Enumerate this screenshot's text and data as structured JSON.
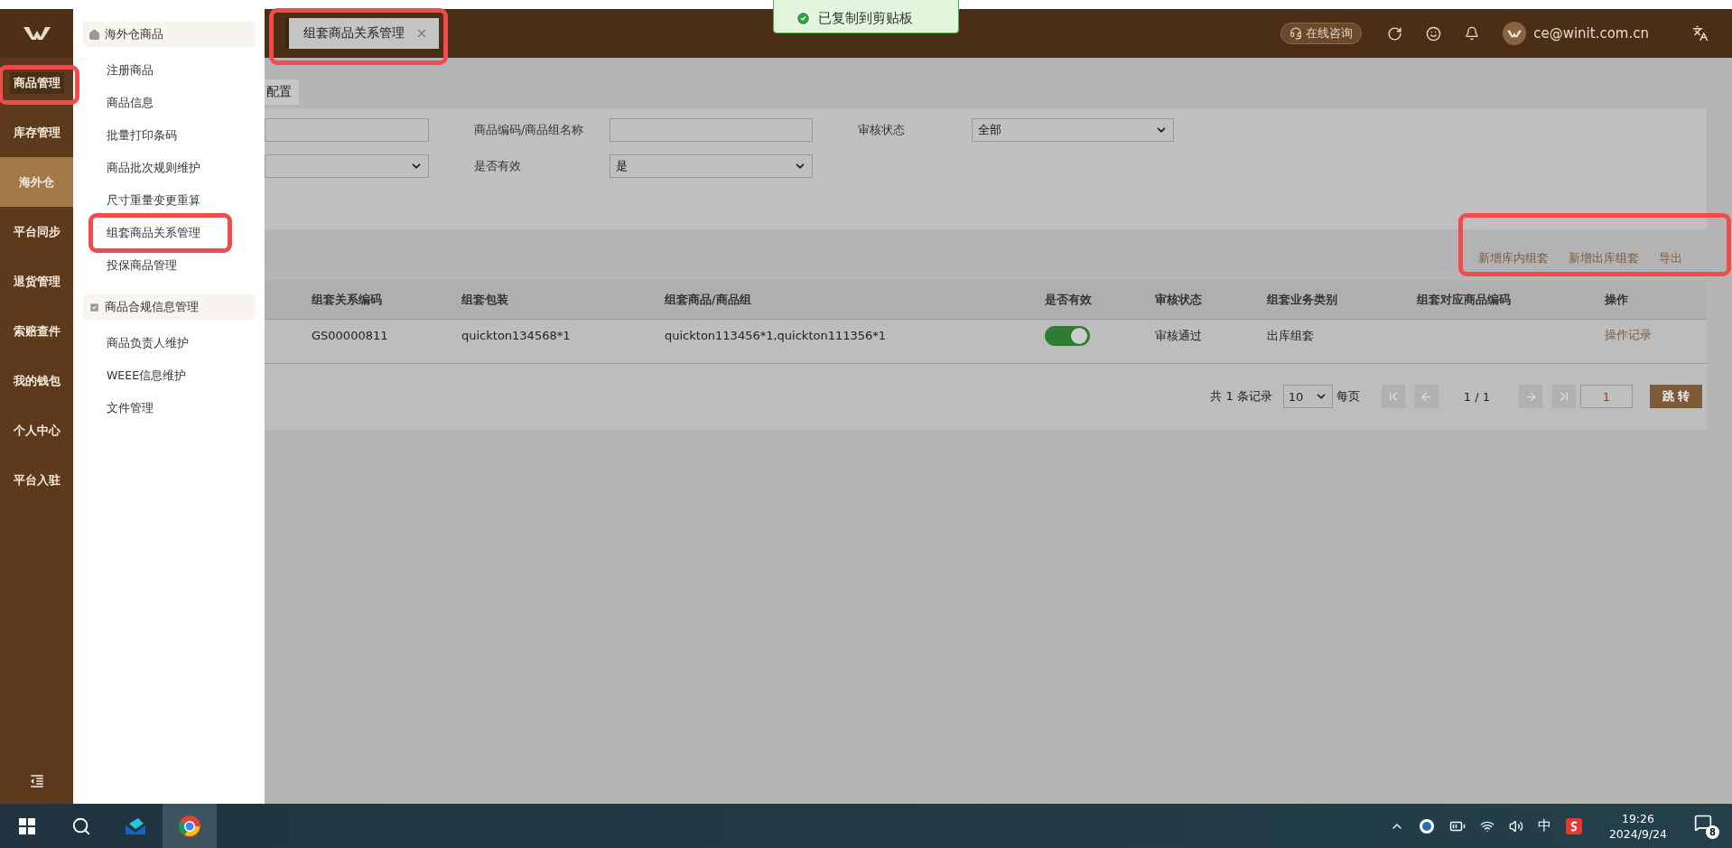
{
  "sidebar": {
    "items": [
      {
        "label": "商品管理",
        "selected": false,
        "annotated": true
      },
      {
        "label": "库存管理",
        "selected": false,
        "annotated": false
      },
      {
        "label": "海外仓",
        "selected": true,
        "annotated": false
      },
      {
        "label": "平台同步",
        "selected": false,
        "annotated": false
      },
      {
        "label": "退货管理",
        "selected": false,
        "annotated": false
      },
      {
        "label": "索赔查件",
        "selected": false,
        "annotated": false
      },
      {
        "label": "我的钱包",
        "selected": false,
        "annotated": false
      },
      {
        "label": "个人中心",
        "selected": false,
        "annotated": false
      },
      {
        "label": "平台入驻",
        "selected": false,
        "annotated": false
      }
    ]
  },
  "menu": {
    "groups": [
      {
        "title": "海外仓商品",
        "items": [
          {
            "label": "注册商品",
            "annotated": false
          },
          {
            "label": "商品信息",
            "annotated": false
          },
          {
            "label": "批量打印条码",
            "annotated": false
          },
          {
            "label": "商品批次规则维护",
            "annotated": false
          },
          {
            "label": "尺寸重量变更重算",
            "annotated": false
          },
          {
            "label": "组套商品关系管理",
            "annotated": true
          },
          {
            "label": "投保商品管理",
            "annotated": false
          }
        ]
      },
      {
        "title": "商品合规信息管理",
        "items": [
          {
            "label": "商品负责人维护",
            "annotated": false
          },
          {
            "label": "WEEE信息维护",
            "annotated": false
          },
          {
            "label": "文件管理",
            "annotated": false
          }
        ]
      }
    ]
  },
  "header": {
    "tabs": [
      {
        "label": "组套商品关系管理",
        "selected": true,
        "annotated": true
      }
    ],
    "consult": "在线咨询",
    "user": "ce@winit.com.cn"
  },
  "toast": {
    "message": "已复制到剪贴板"
  },
  "subtabs": [
    {
      "label": "配置",
      "selected": true
    }
  ],
  "filters": [
    [
      {
        "kind": "input"
      },
      {
        "kind": "label",
        "text": "商品编码/商品组名称"
      },
      {
        "kind": "input"
      },
      {
        "kind": "label",
        "text": "审核状态"
      },
      {
        "kind": "select",
        "value": "全部"
      }
    ],
    [
      {
        "kind": "select"
      },
      {
        "kind": "label",
        "text": "是否有效"
      },
      {
        "kind": "select",
        "value": "是"
      }
    ]
  ],
  "toolbar": {
    "annotated": true,
    "actions": [
      "新增库内组套",
      "新增出库组套",
      "导出"
    ]
  },
  "table": {
    "columns": [
      "组套关系编码",
      "组套包装",
      "组套商品/商品组",
      "是否有效",
      "审核状态",
      "组套业务类别",
      "组套对应商品编码",
      "操作"
    ],
    "rows": [
      {
        "code": "GS00000811",
        "package": "quickton134568*1",
        "items": "quickton113456*1,quickton111356*1",
        "valid": true,
        "status": "审核通过",
        "type": "出库组套",
        "action": "操作记录"
      }
    ]
  },
  "pagination": {
    "total": "共 1 条记录",
    "page_size": "10",
    "per_page": "每页",
    "page": "1 / 1",
    "jump_value": "1",
    "jump": "跳 转"
  },
  "taskbar": {
    "ime": "中",
    "time": "19:26",
    "date": "2024/9/24",
    "notifications": "8"
  }
}
